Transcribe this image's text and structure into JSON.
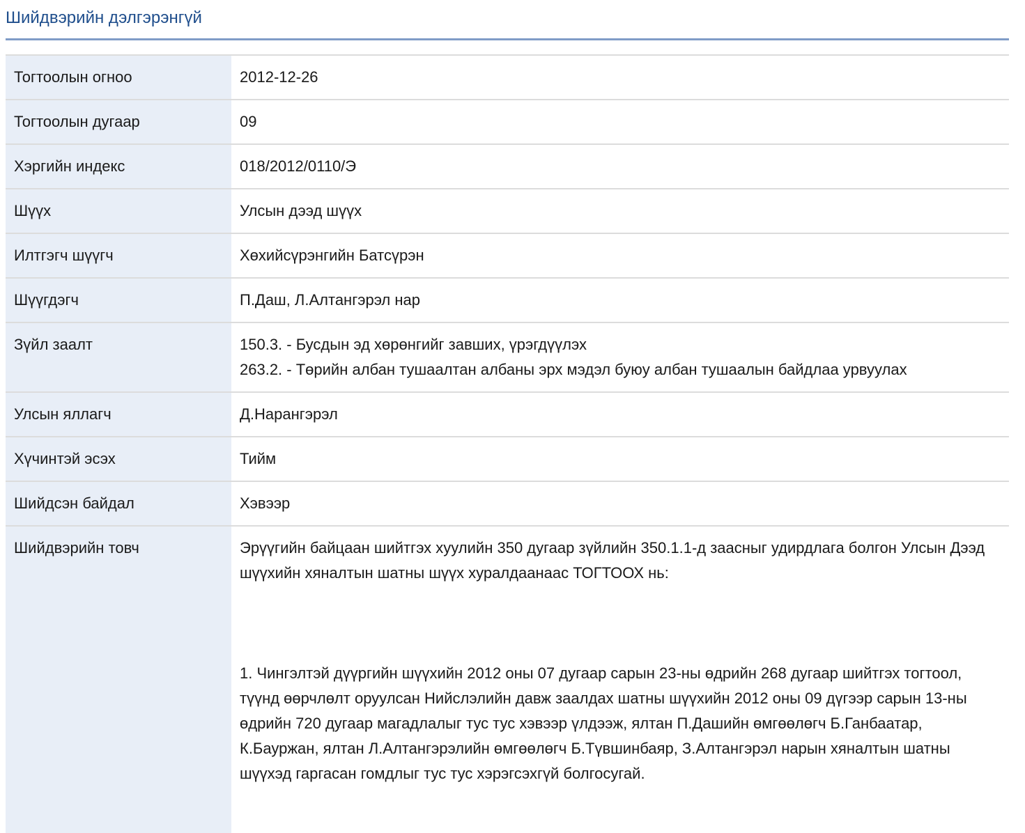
{
  "header": {
    "title": "Шийдвэрийн дэлгэрэнгүй"
  },
  "details": {
    "date": {
      "label": "Тогтоолын огноо",
      "value": "2012-12-26"
    },
    "number": {
      "label": "Тогтоолын дугаар",
      "value": "09"
    },
    "case_index": {
      "label": "Хэргийн индекс",
      "value": "018/2012/0110/Э"
    },
    "court": {
      "label": "Шүүх",
      "value": "Улсын дээд шүүх"
    },
    "presiding_judge": {
      "label": "Илтгэгч шүүгч",
      "value": "Хөхийсүрэнгийн Батсүрэн"
    },
    "defendant": {
      "label": "Шүүгдэгч",
      "value": "П.Даш, Л.Алтангэрэл нар"
    },
    "articles": {
      "label": "Зүйл заалт",
      "lines": [
        "150.3. - Бусдын эд хөрөнгийг завших, үрэгдүүлэх",
        "263.2. - Төрийн албан тушаалтан албаны эрх мэдэл буюу албан тушаалын байдлаа урвуулах"
      ]
    },
    "prosecutor": {
      "label": "Улсын яллагч",
      "value": "Д.Нарангэрэл"
    },
    "effective": {
      "label": "Хүчинтэй эсэх",
      "value": "Тийм"
    },
    "outcome": {
      "label": "Шийдсэн байдал",
      "value": "Хэвээр"
    },
    "summary": {
      "label": "Шийдвэрийн товч",
      "paragraph1": "Эрүүгийн байцаан шийтгэх хуулийн 350 дугаар зүйлийн 350.1.1-д заасныг удирдлага болгон Улсын Дээд шүүхийн хяналтын шатны шүүх хуралдаанаас ТОГТООХ нь:",
      "paragraph2": "1. Чингэлтэй дүүргийн шүүхийн 2012 оны 07 дугаар сарын 23-ны өдрийн 268 дугаар шийтгэх тогтоол, түүнд өөрчлөлт оруулсан Нийслэлийн давж заалдах шатны шүүхийн 2012 оны 09 дүгээр сарын 13-ны өдрийн 720 дугаар магадлалыг тус тус хэвээр үлдээж, ялтан П.Дашийн өмгөөлөгч Б.Ганбаатар, К.Бауржан, ялтан Л.Алтангэрэлийн өмгөөлөгч Б.Түвшинбаяр, З.Алтангэрэл нарын хяналтын шатны шүүхэд гаргасан гомдлыг тус тус хэрэгсэхгүй болгосугай."
    }
  },
  "colors": {
    "title": "#1f4e8c",
    "rule": "#7f9cc7",
    "label_bg": "#e8eef7",
    "row_border": "#dcdcdc"
  }
}
